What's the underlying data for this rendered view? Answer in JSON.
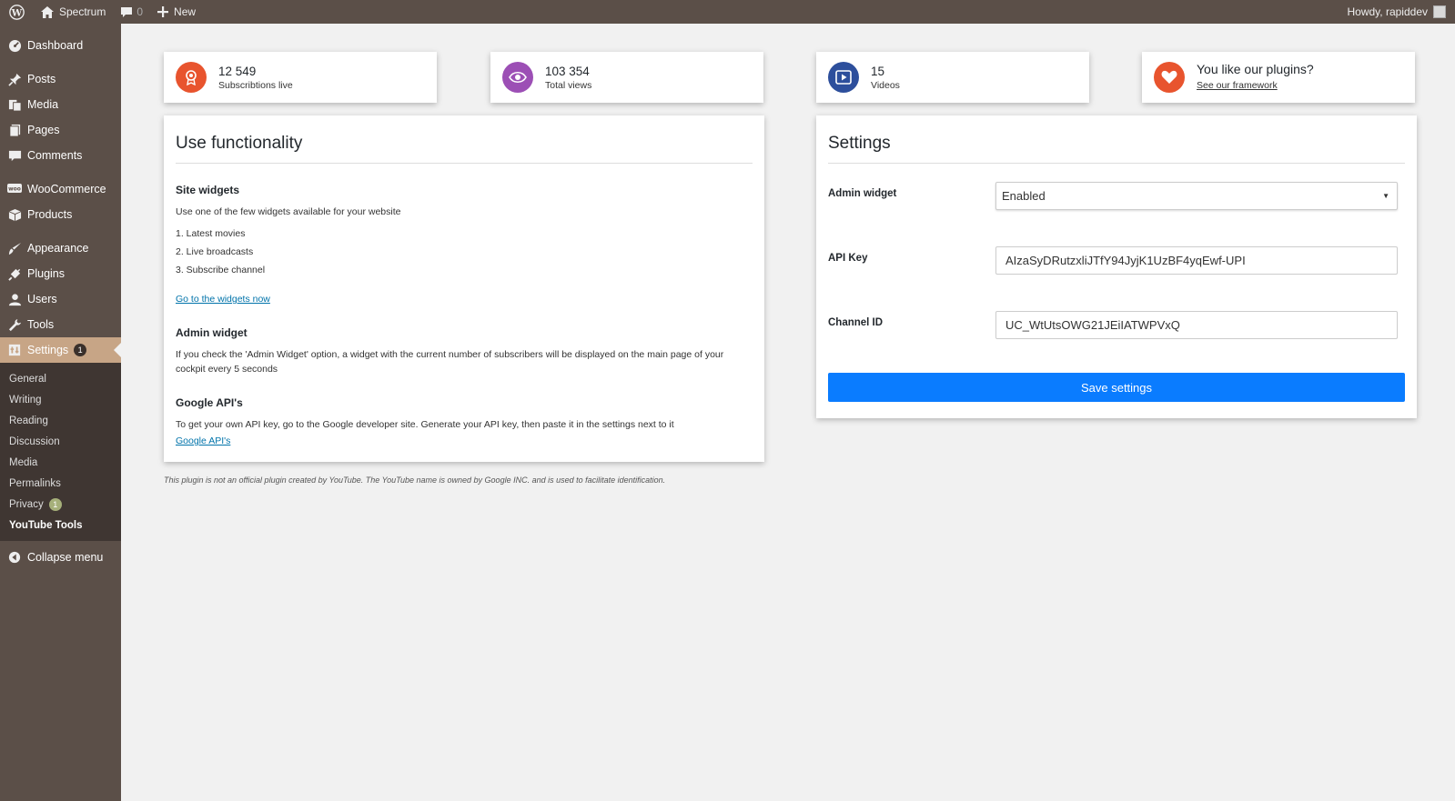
{
  "adminbar": {
    "site_name": "Spectrum",
    "comments_count": "0",
    "new_label": "New",
    "howdy": "Howdy, rapiddev"
  },
  "sidebar": {
    "items": [
      {
        "label": "Dashboard",
        "icon": "dashboard-icon"
      },
      {
        "label": "Posts",
        "icon": "pin-icon"
      },
      {
        "label": "Media",
        "icon": "media-icon"
      },
      {
        "label": "Pages",
        "icon": "pages-icon"
      },
      {
        "label": "Comments",
        "icon": "comment-icon"
      },
      {
        "label": "WooCommerce",
        "icon": "woo-icon"
      },
      {
        "label": "Products",
        "icon": "box-icon"
      },
      {
        "label": "Appearance",
        "icon": "brush-icon"
      },
      {
        "label": "Plugins",
        "icon": "plug-icon"
      },
      {
        "label": "Users",
        "icon": "user-icon"
      },
      {
        "label": "Tools",
        "icon": "wrench-icon"
      },
      {
        "label": "Settings",
        "icon": "settings-icon",
        "badge": "1"
      }
    ],
    "submenu": [
      {
        "label": "General"
      },
      {
        "label": "Writing"
      },
      {
        "label": "Reading"
      },
      {
        "label": "Discussion"
      },
      {
        "label": "Media"
      },
      {
        "label": "Permalinks"
      },
      {
        "label": "Privacy",
        "badge": "1"
      },
      {
        "label": "YouTube Tools"
      }
    ],
    "collapse": "Collapse menu"
  },
  "stats": [
    {
      "value": "12 549",
      "label": "Subscribtions live",
      "color": "#e8542e",
      "icon": "award-icon"
    },
    {
      "value": "103 354",
      "label": "Total views",
      "color": "#9c4fb5",
      "icon": "eye-icon"
    },
    {
      "value": "15",
      "label": "Videos",
      "color": "#2d4f9c",
      "icon": "video-play-icon"
    }
  ],
  "promo": {
    "title": "You like our plugins?",
    "link": "See our framework",
    "color": "#e8542e",
    "icon": "heart-icon"
  },
  "functionality": {
    "title": "Use functionality",
    "site_widgets_title": "Site widgets",
    "site_widgets_text": "Use one of the few widgets available for your website",
    "list": [
      "1. Latest movies",
      "2. Live broadcasts",
      "3. Subscribe channel"
    ],
    "widgets_link": "Go to the widgets now",
    "admin_widget_title": "Admin widget",
    "admin_widget_text": "If you check the 'Admin Widget' option, a widget with the current number of subscribers will be displayed on the main page of your cockpit every 5 seconds",
    "google_title": "Google API's",
    "google_text": "To get your own API key, go to the Google developer site. Generate your API key, then paste it in the settings next to it",
    "google_link": "Google API's"
  },
  "settings": {
    "title": "Settings",
    "admin_widget_label": "Admin widget",
    "admin_widget_value": "Enabled",
    "api_key_label": "API Key",
    "api_key_value": "AIzaSyDRutzxliJTfY94JyjK1UzBF4yqEwf-UPI",
    "channel_label": "Channel ID",
    "channel_value": "UC_WtUtsOWG21JEiIATWPVxQ",
    "save_label": "Save settings"
  },
  "disclaimer": "This plugin is not an official plugin created by YouTube. The YouTube name is owned by Google INC. and is used to facilitate identification."
}
